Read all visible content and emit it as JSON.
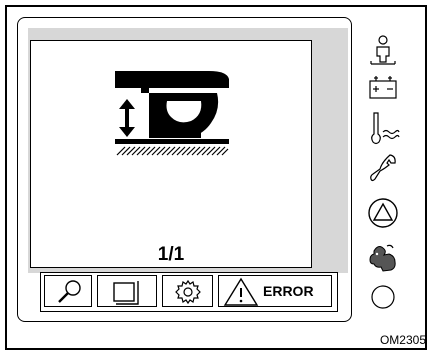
{
  "display": {
    "page_indicator": "1/1"
  },
  "toolbar": {
    "search_icon": "magnifier-icon",
    "pages_icon": "pages-icon",
    "settings_icon": "gear-icon",
    "error_label": "ERROR"
  },
  "side_icons": [
    "operator-icon",
    "battery-icon",
    "coolant-temperature-icon",
    "wrench-icon",
    "warning-triangle-icon",
    "turtle-hare-speed-icon",
    "indicator-light-icon"
  ],
  "caption": "OM2305"
}
